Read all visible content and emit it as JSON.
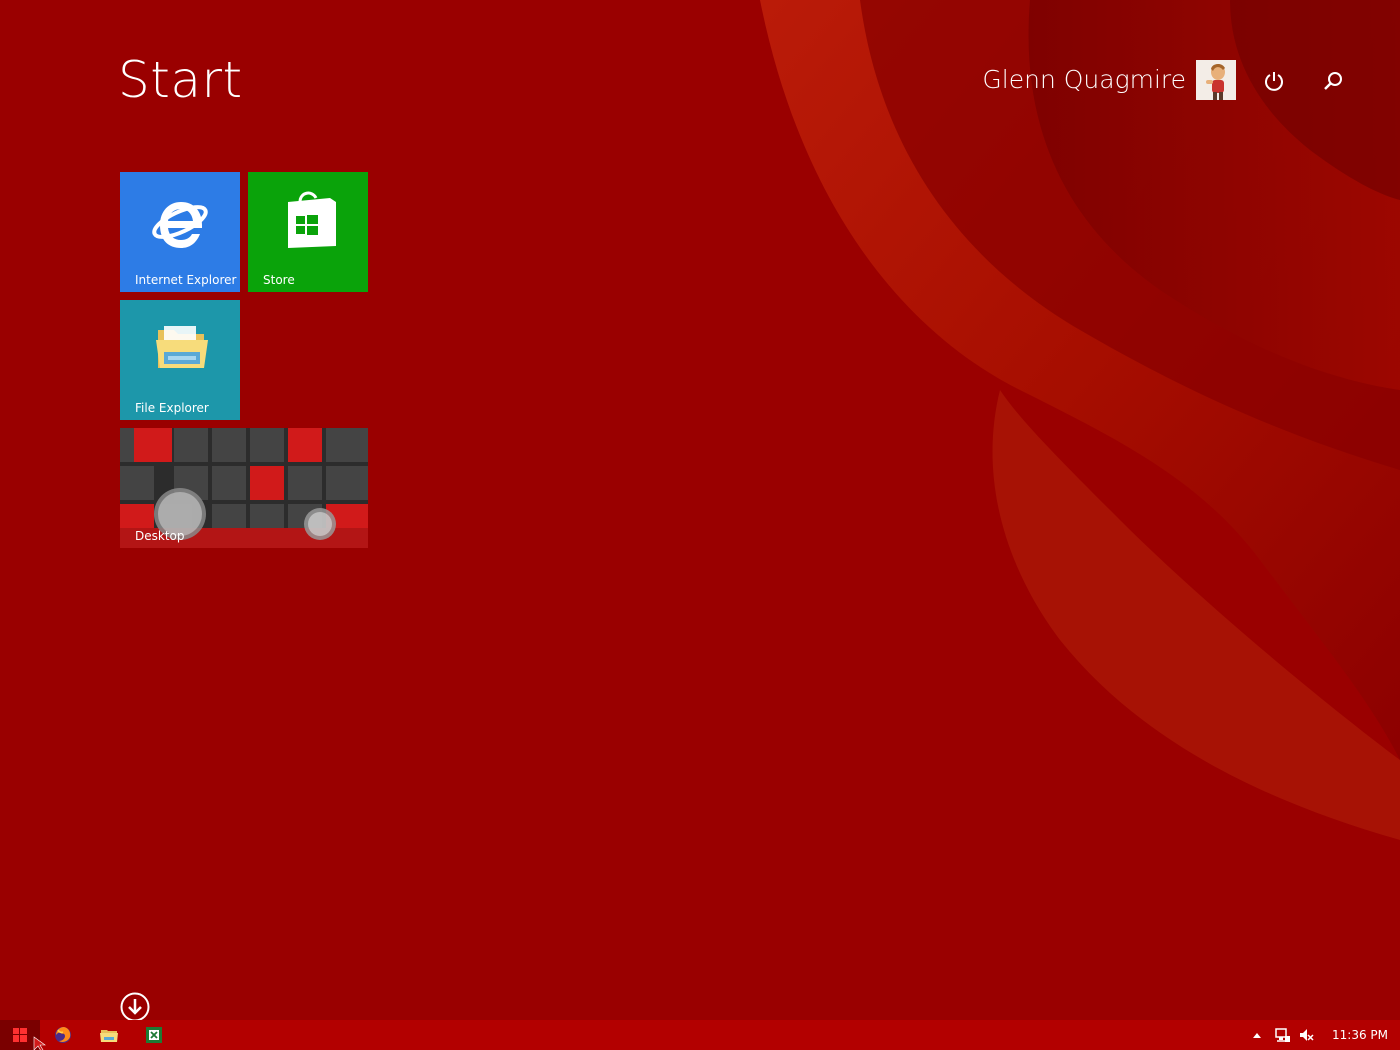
{
  "start_screen": {
    "title": "Start",
    "user_name": "Glenn Quagmire",
    "background_color": "#9a0000"
  },
  "header": {
    "power_icon": "power-icon",
    "search_icon": "search-icon"
  },
  "tiles": [
    {
      "label": "Internet Explorer",
      "icon": "internet-explorer-icon",
      "color": "#2d7ce6"
    },
    {
      "label": "Store",
      "icon": "store-icon",
      "color": "#0aa30a"
    },
    {
      "label": "File Explorer",
      "icon": "file-explorer-icon",
      "color": "#1d97aa"
    },
    {
      "label": "Desktop",
      "icon": "desktop-wallpaper",
      "color": "#333333"
    }
  ],
  "all_apps": {
    "icon": "arrow-down-circle-icon"
  },
  "taskbar": {
    "pinned": [
      {
        "name": "start-button",
        "icon": "windows-logo-icon"
      },
      {
        "name": "firefox",
        "icon": "firefox-icon"
      },
      {
        "name": "file-explorer",
        "icon": "folder-icon"
      },
      {
        "name": "excel",
        "icon": "excel-icon"
      }
    ],
    "tray": {
      "show_hidden_icon": "chevron-up-icon",
      "network_icon": "network-icon",
      "volume_icon": "volume-muted-icon"
    },
    "clock": "11:36 PM"
  }
}
